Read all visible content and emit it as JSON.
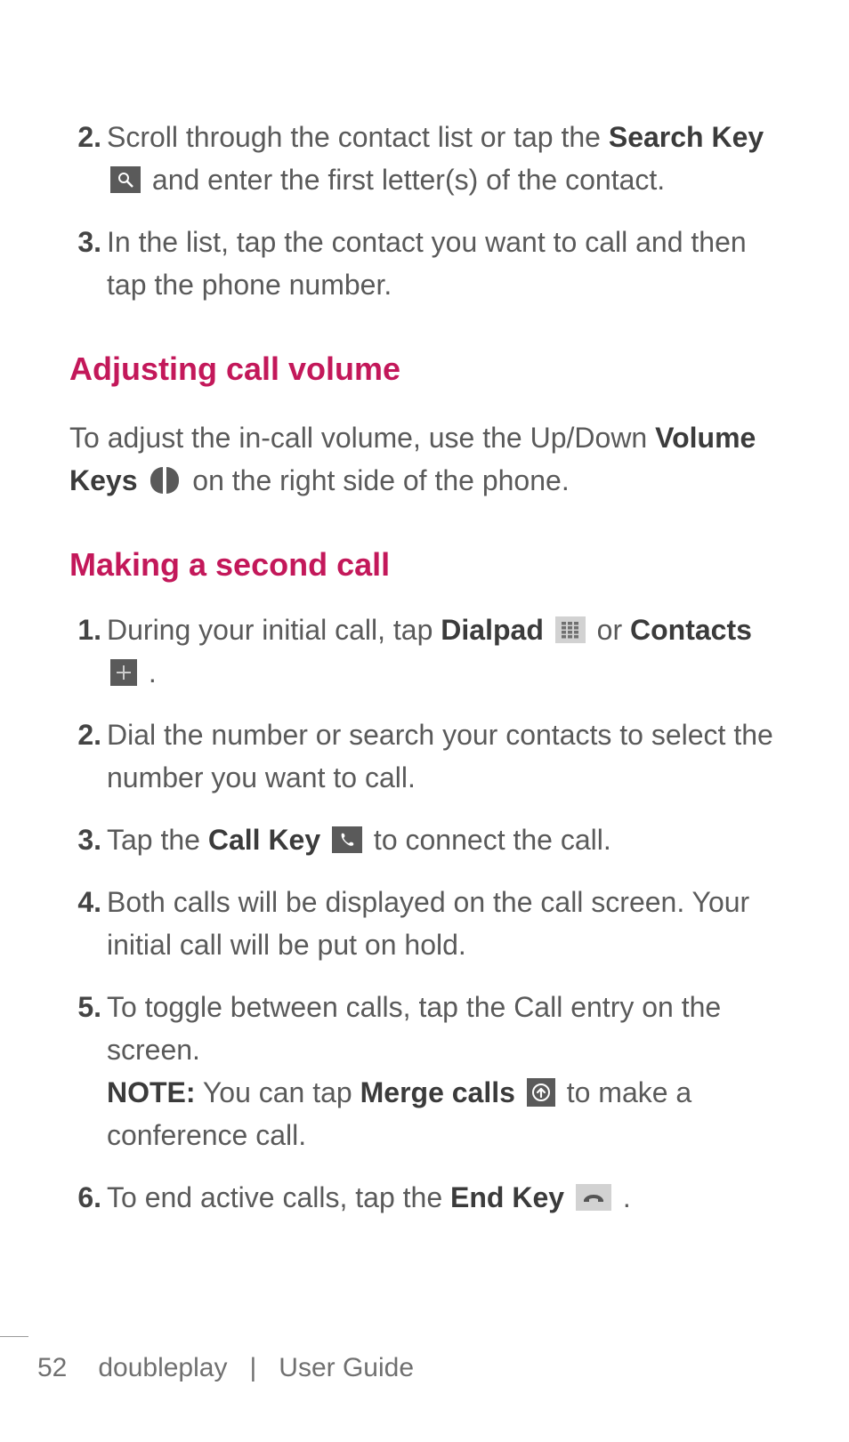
{
  "steps_top": [
    {
      "num": "2.",
      "pre": "Scroll through the contact list or tap the ",
      "bold": "Search Key",
      "icon": "search",
      "post": " and enter the first letter(s) of the contact."
    },
    {
      "num": "3.",
      "text": "In the list, tap the contact you want to call and then tap the phone number."
    }
  ],
  "section1": {
    "heading": "Adjusting call volume",
    "para_pre": "To adjust the in-call volume, use the Up/Down ",
    "para_bold": "Volume Keys",
    "para_post": " on the right side of the phone."
  },
  "section2": {
    "heading": "Making a second call",
    "steps": [
      {
        "num": "1.",
        "parts": [
          {
            "t": "During your initial call, tap "
          },
          {
            "bold": "Dialpad"
          },
          {
            "icon": "dialpad"
          },
          {
            "t": " or "
          },
          {
            "bold": "Contacts"
          },
          {
            "icon": "contacts"
          },
          {
            "t": "."
          }
        ]
      },
      {
        "num": "2.",
        "parts": [
          {
            "t": "Dial the number or search your contacts to select the number you want to call."
          }
        ]
      },
      {
        "num": "3.",
        "parts": [
          {
            "t": "Tap the "
          },
          {
            "bold": "Call Key"
          },
          {
            "icon": "call"
          },
          {
            "t": " to connect the call."
          }
        ]
      },
      {
        "num": "4.",
        "parts": [
          {
            "t": "Both calls will be displayed on the call screen. Your initial call will be put on hold."
          }
        ]
      },
      {
        "num": "5.",
        "parts": [
          {
            "t": "To toggle between calls, tap the Call entry on the screen."
          },
          {
            "br": true
          },
          {
            "bold": "NOTE:"
          },
          {
            "t": " You can tap "
          },
          {
            "bold": "Merge calls"
          },
          {
            "icon": "merge"
          },
          {
            "t": " to make a conference call."
          }
        ]
      },
      {
        "num": "6.",
        "parts": [
          {
            "t": "To end active calls, tap the "
          },
          {
            "bold": "End Key"
          },
          {
            "icon": "end"
          },
          {
            "t": "."
          }
        ]
      }
    ]
  },
  "footer": {
    "page_number": "52",
    "product": "doubleplay",
    "separator": "|",
    "guide": "User Guide"
  }
}
